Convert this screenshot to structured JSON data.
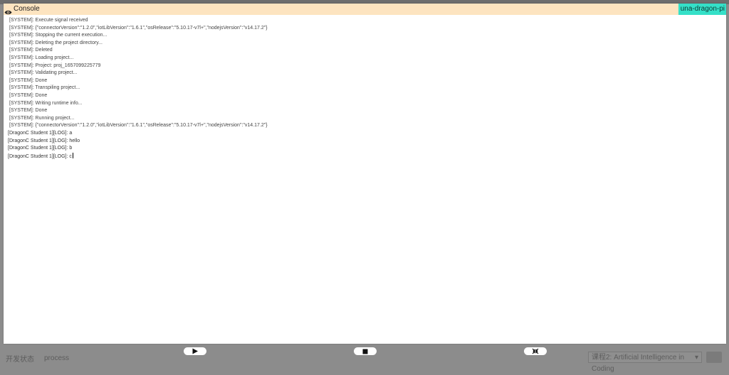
{
  "console": {
    "title": "Console",
    "device": "una-dragon-pi",
    "lines": [
      {
        "kind": "system",
        "text": "[SYSTEM]: Execute signal received"
      },
      {
        "kind": "system",
        "text": "[SYSTEM]: {\"connectorVersion\":\"1.2.0\",\"iotLibVersion\":\"1.6.1\",\"osRelease\":\"5.10.17-v7l+\",\"nodejsVersion\":\"v14.17.2\"}"
      },
      {
        "kind": "system",
        "text": "[SYSTEM]: Stopping the current execution..."
      },
      {
        "kind": "system",
        "text": "[SYSTEM]: Deleting the project directory..."
      },
      {
        "kind": "system",
        "text": "[SYSTEM]: Deleted"
      },
      {
        "kind": "system",
        "text": "[SYSTEM]: Loading project..."
      },
      {
        "kind": "system",
        "text": "[SYSTEM]: Project: proj_1657099225779"
      },
      {
        "kind": "system",
        "text": "[SYSTEM]: Validating project..."
      },
      {
        "kind": "system",
        "text": "[SYSTEM]: Done"
      },
      {
        "kind": "system",
        "text": "[SYSTEM]: Transpiling project..."
      },
      {
        "kind": "system",
        "text": "[SYSTEM]: Done"
      },
      {
        "kind": "system",
        "text": "[SYSTEM]: Writing runtime info..."
      },
      {
        "kind": "system",
        "text": "[SYSTEM]: Done"
      },
      {
        "kind": "system",
        "text": "[SYSTEM]: Running project..."
      },
      {
        "kind": "system",
        "text": "[SYSTEM]: {\"connectorVersion\":\"1.2.0\",\"iotLibVersion\":\"1.6.1\",\"osRelease\":\"5.10.17-v7l+\",\"nodejsVersion\":\"v14.17.2\"}"
      },
      {
        "kind": "user",
        "text": "[DragonC Student 1][LOG]: a"
      },
      {
        "kind": "user",
        "text": "[DragonC Student 1][LOG]: hello"
      },
      {
        "kind": "user",
        "text": "[DragonC Student 1][LOG]: b"
      },
      {
        "kind": "user",
        "text": "[DragonC Student 1][LOG]: c"
      }
    ]
  },
  "controls": {
    "run_icon": "play-icon",
    "stop_icon": "stop-icon",
    "expand_icon": "collapse-arrows-icon"
  },
  "background": {
    "left_label": "开发状态",
    "left_value": "process",
    "course_select": "课程2: Artificial Intelligence in Coding"
  },
  "colors": {
    "header_bg": "#fde4c0",
    "device_badge_bg": "#35e0c8",
    "overlay_bg": "#8c8c8c"
  }
}
